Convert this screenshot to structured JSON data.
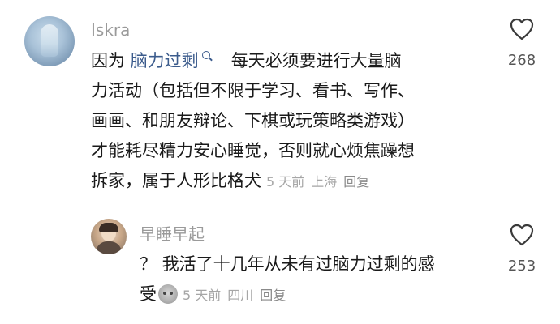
{
  "comments": [
    {
      "username": "Iskra",
      "content_prefix": "因为 ",
      "link_text": "脑力过剩",
      "content_lines_first_rest": "每天必须要进行大量脑",
      "content_lines": [
        "力活动（包括但不限于学习、看书、写作、",
        "画画、和朋友辩论、下棋或玩策略类游戏）",
        "才能耗尽精力安心睡觉，否则就心烦焦躁想"
      ],
      "content_last": "拆家，属于人形比格犬",
      "time": "5 天前",
      "location": "上海",
      "reply_label": "回复",
      "likes": "268"
    },
    {
      "username": "早睡早起",
      "content_line1": "？ 我活了十几年从未有过脑力过剩的感",
      "content_line2": "受",
      "time": "5 天前",
      "location": "四川",
      "reply_label": "回复",
      "likes": "253"
    }
  ],
  "icons": {
    "like": "heart-outline-icon",
    "link_suffix": "search-icon",
    "emoji": "emoji-icon"
  },
  "colors": {
    "link": "#3b5b8c",
    "username": "#9a9a9a",
    "meta": "#a6a6a6"
  }
}
